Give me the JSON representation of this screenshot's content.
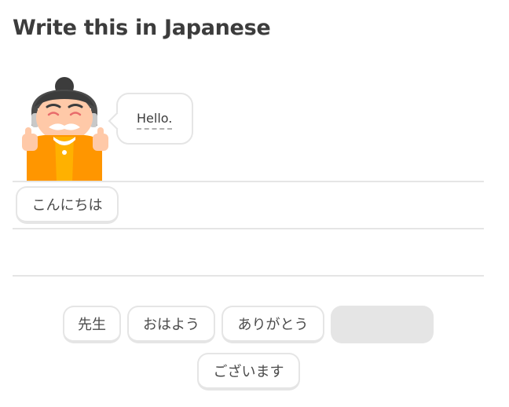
{
  "header": {
    "title": "Write this in Japanese"
  },
  "prompt": {
    "text": "Hello."
  },
  "answer": {
    "selected_tiles": [
      "こんにちは"
    ]
  },
  "word_bank": {
    "tiles": [
      "先生",
      "おはよう",
      "ありがとう",
      "",
      "ございます"
    ]
  },
  "colors": {
    "border": "#e5e5e5",
    "text": "#4b4b4b",
    "character_orange": "#ff9600"
  }
}
